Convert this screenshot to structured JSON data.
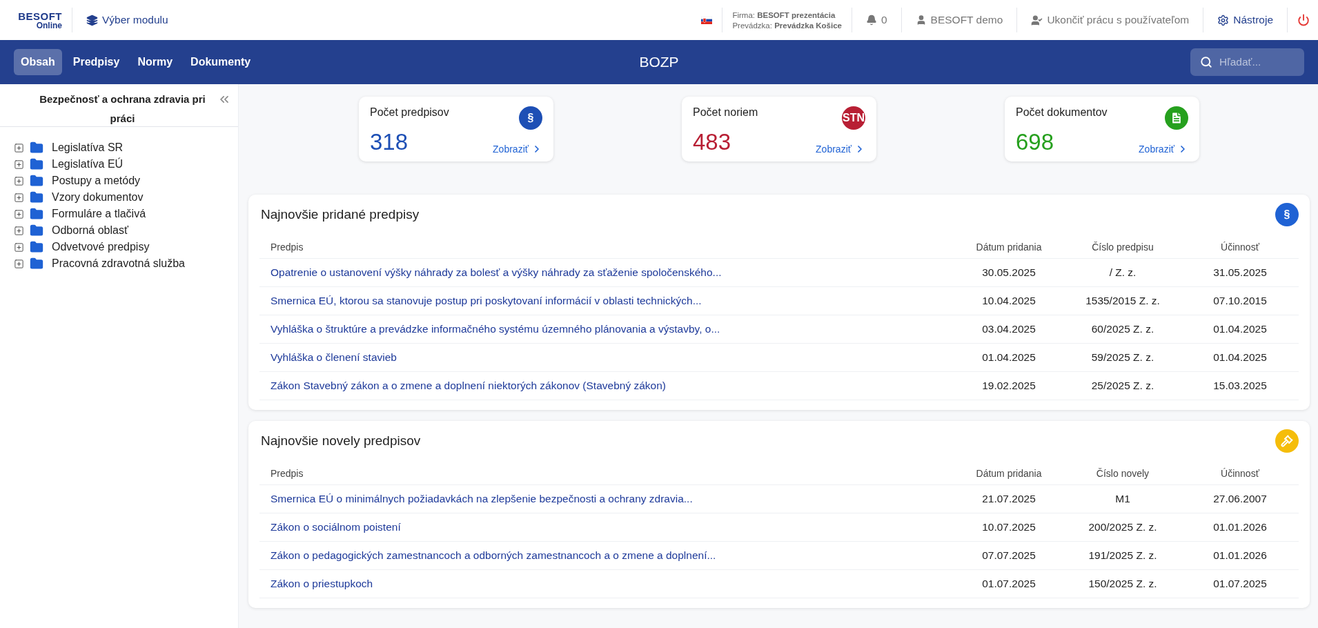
{
  "topbar": {
    "logo": {
      "brand": "BESOFT",
      "sub": "Online"
    },
    "module_button": "Výber modulu",
    "company": "Firma: **BESOFT prezentácia**",
    "branch": "Prevádzka: **Prevádzka Košice**",
    "notifications": "0",
    "user": "BESOFT demo",
    "end_session": "Ukončiť prácu s používateľom",
    "tools": "Nástroje"
  },
  "nav": {
    "tabs": [
      {
        "label": "Obsah",
        "selected": true
      },
      {
        "label": "Predpisy",
        "selected": false
      },
      {
        "label": "Normy",
        "selected": false
      },
      {
        "label": "Dokumenty",
        "selected": false
      }
    ],
    "title": "BOZP",
    "search": {
      "placeholder": "Hľadať..."
    }
  },
  "sidebar": {
    "title": "Bezpečnosť a ochrana zdravia pri práci",
    "items": [
      {
        "label": "Legislatíva SR",
        "expanded": false
      },
      {
        "label": "Legislatíva EÚ",
        "expanded": false
      },
      {
        "label": "Postupy a metódy",
        "expanded": false
      },
      {
        "label": "Vzory dokumentov",
        "expanded": false
      },
      {
        "label": "Formuláre a tlačivá",
        "expanded": false
      },
      {
        "label": "Odborná oblasť",
        "expanded": false
      },
      {
        "label": "Odvetvové predpisy",
        "expanded": false
      },
      {
        "label": "Pracovná zdravotná služba",
        "expanded": false
      }
    ]
  },
  "cards": [
    {
      "label": "Počet predpisov",
      "value": "318",
      "kind": "text",
      "badge": "§",
      "color": "#1d4fb5",
      "link": "Zobraziť"
    },
    {
      "label": "Počet noriem",
      "value": "483",
      "kind": "text",
      "badge": "STN",
      "color": "#b81f34",
      "link": "Zobraziť"
    },
    {
      "label": "Počet dokumentov",
      "value": "698",
      "kind": "document",
      "color": "#26a01e",
      "link": "Zobraziť"
    }
  ],
  "panels": [
    {
      "title": "Najnovšie pridané predpisy",
      "kind": "text",
      "badge": "§",
      "color": "#1f62d4",
      "columns": [
        "Predpis",
        "Dátum pridania",
        "Číslo predpisu",
        "Účinnosť"
      ],
      "rows": [
        [
          "Opatrenie o ustanovení výšky náhrady za bolesť a výšky náhrady za sťaženie spoločenského...",
          "30.05.2025",
          "/ Z. z.",
          "31.05.2025"
        ],
        [
          "Smernica EÚ, ktorou sa stanovuje postup pri poskytovaní informácií v oblasti technických...",
          "10.04.2025",
          "1535/2015 Z. z.",
          "07.10.2015"
        ],
        [
          "Vyhláška o štruktúre a prevádzke informačného systému územného plánovania a výstavby, o...",
          "03.04.2025",
          "60/2025 Z. z.",
          "01.04.2025"
        ],
        [
          "Vyhláška o členení stavieb",
          "01.04.2025",
          "59/2025 Z. z.",
          "01.04.2025"
        ],
        [
          "Zákon Stavebný zákon a o zmene a doplnení niektorých zákonov (Stavebný zákon)",
          "19.02.2025",
          "25/2025 Z. z.",
          "15.03.2025"
        ]
      ]
    },
    {
      "title": "Najnovšie novely predpisov",
      "kind": "gavel",
      "color": "#f5bd0a",
      "columns": [
        "Predpis",
        "Dátum pridania",
        "Číslo novely",
        "Účinnosť"
      ],
      "rows": [
        [
          "Smernica EÚ o minimálnych požiadavkách na zlepšenie bezpečnosti a ochrany zdravia...",
          "21.07.2025",
          "M1",
          "27.06.2007"
        ],
        [
          "Zákon o sociálnom poistení",
          "10.07.2025",
          "200/2025 Z. z.",
          "01.01.2026"
        ],
        [
          "Zákon o pedagogických zamestnancoch a odborných zamestnancoch a o zmene a doplnení...",
          "07.07.2025",
          "191/2025 Z. z.",
          "01.01.2026"
        ],
        [
          "Zákon o priestupkoch",
          "01.07.2025",
          "150/2025 Z. z.",
          "01.07.2025"
        ]
      ]
    }
  ]
}
